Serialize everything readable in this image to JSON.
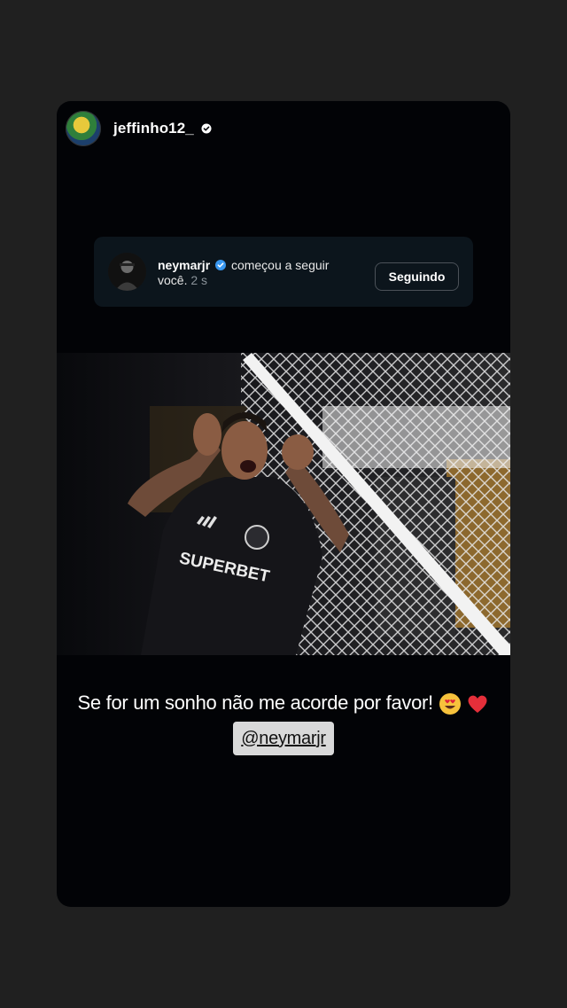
{
  "story": {
    "username": "jeffinho12_",
    "follow_card": {
      "name": "neymarjr",
      "action": "começou a seguir",
      "target": "você.",
      "time": "2 s",
      "button_label": "Seguindo"
    },
    "photo": {
      "jersey_sponsor": "SUPERBET"
    },
    "caption": "Se for um sonho não me acorde por favor!",
    "caption_emojis": [
      "smiling-face-with-heart-eyes",
      "red-heart"
    ],
    "mention": "@neymarjr"
  },
  "colors": {
    "page_background": "#202020",
    "story_background": "#020306",
    "card_background": "#0c151c",
    "verified_blue": "#3897f0",
    "mention_background": "#d9d9d9"
  }
}
